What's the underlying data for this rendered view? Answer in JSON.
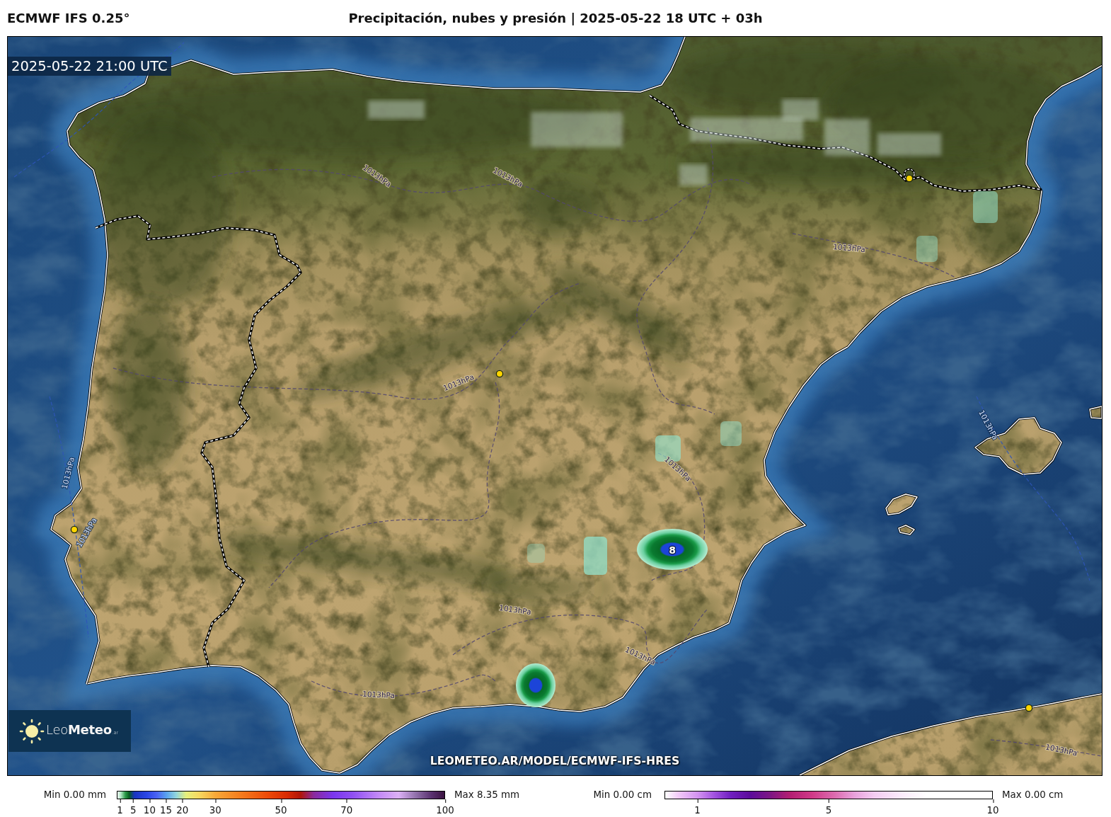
{
  "header": {
    "model": "ECMWF IFS 0.25°",
    "title": "Precipitación, nubes y presión | 2025-05-22 18 UTC + 03h"
  },
  "map": {
    "valid_time": "2025-05-22 21:00 UTC",
    "max_value": "8",
    "isobar_labels": [
      "1013hPa",
      "1013hPa",
      "1013hPa",
      "1013hPa",
      "1013hPa",
      "1013hPa",
      "1013hPa",
      "1013hPa",
      "1013hPa",
      "1013hPa",
      "1013hPa",
      "1013hPa"
    ],
    "logo": "Leo**Meteo**$_{.ar}$",
    "source_url": "LEOMETEO.AR/MODEL/ECMWF-IFS-HRES"
  },
  "legends": [
    {
      "kind": "precipitation",
      "min": "Min 0.00 mm",
      "max": "Max 8.35 mm",
      "ticks": [
        "1",
        "5",
        "10",
        "15",
        "20",
        "30",
        "50",
        "70",
        "100"
      ]
    },
    {
      "kind": "snow",
      "min": "Min 0.00 cm",
      "max": "Max 0.00 cm",
      "ticks": [
        "1",
        "5",
        "10"
      ]
    }
  ]
}
